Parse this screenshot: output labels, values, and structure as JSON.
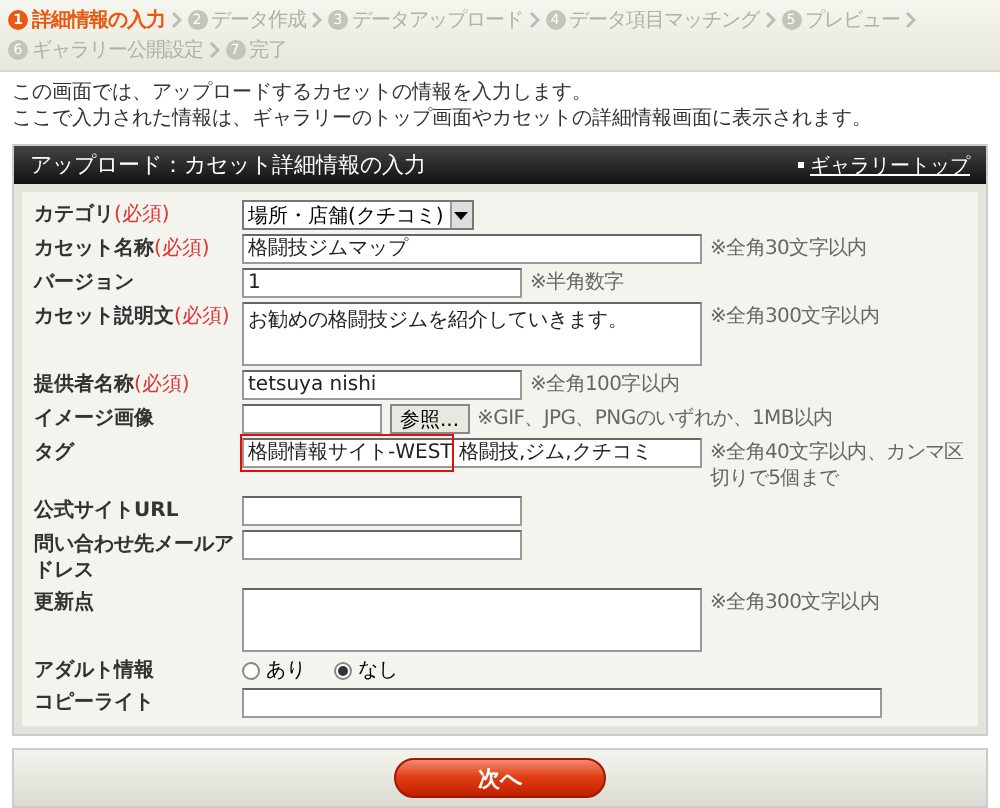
{
  "breadcrumb": [
    {
      "number": "1",
      "label": "詳細情報の入力",
      "selected": true
    },
    {
      "number": "2",
      "label": "データ作成",
      "selected": false
    },
    {
      "number": "3",
      "label": "データアップロード",
      "selected": false
    },
    {
      "number": "4",
      "label": "データ項目マッチング",
      "selected": false
    },
    {
      "number": "5",
      "label": "プレビュー",
      "selected": false
    },
    {
      "number": "6",
      "label": "ギャラリー公開設定",
      "selected": false
    },
    {
      "number": "7",
      "label": "完了",
      "selected": false
    }
  ],
  "intro": [
    "この画面では、アップロードするカセットの情報を入力します。",
    "ここで入力された情報は、ギャラリーのトップ画面やカセットの詳細情報画面に表示されます。"
  ],
  "panel": {
    "title": "アップロード：カセット詳細情報の入力",
    "link": "ギャラリートップ"
  },
  "fields": [
    {
      "kind": "select",
      "label": "カテゴリ",
      "required": "(必須)",
      "value": "場所・店舗(クチコミ)"
    },
    {
      "kind": "text_wide",
      "label": "カセット名称",
      "required": "(必須)",
      "value": "格闘技ジムマップ",
      "note": "※全角30文字以内"
    },
    {
      "kind": "text",
      "label": "バージョン",
      "value": "1",
      "note": "※半角数字"
    },
    {
      "kind": "textarea",
      "label": "カセット説明文",
      "required": "(必須)",
      "value": "お勧めの格闘技ジムを紹介していきます。",
      "note": "※全角300文字以内"
    },
    {
      "kind": "text",
      "label": "提供者名称",
      "required": "(必須)",
      "value": "tetsuya nishi",
      "note": "※全角100字以内"
    },
    {
      "kind": "file",
      "label": "イメージ画像",
      "button": "参照...",
      "note": "※GIF、JPG、PNGのいずれか、1MB以内"
    },
    {
      "kind": "text_wide",
      "label": "タグ",
      "value": "格闘情報サイト-WEST 格闘技,ジム,クチコミ",
      "highlighted": true,
      "note": "※全角40文字以内、カンマ区切りで5個まで"
    },
    {
      "kind": "text",
      "label": "公式サイトURL"
    },
    {
      "kind": "text",
      "label": "問い合わせ先メールアドレス"
    },
    {
      "kind": "textarea",
      "label": "更新点",
      "note": "※全角300文字以内"
    },
    {
      "kind": "radio",
      "label": "アダルト情報",
      "options": [
        {
          "label": "あり",
          "selected": false
        },
        {
          "label": "なし",
          "selected": true
        }
      ]
    },
    {
      "kind": "text_full",
      "label": "コピーライト"
    }
  ],
  "submit": "次へ"
}
